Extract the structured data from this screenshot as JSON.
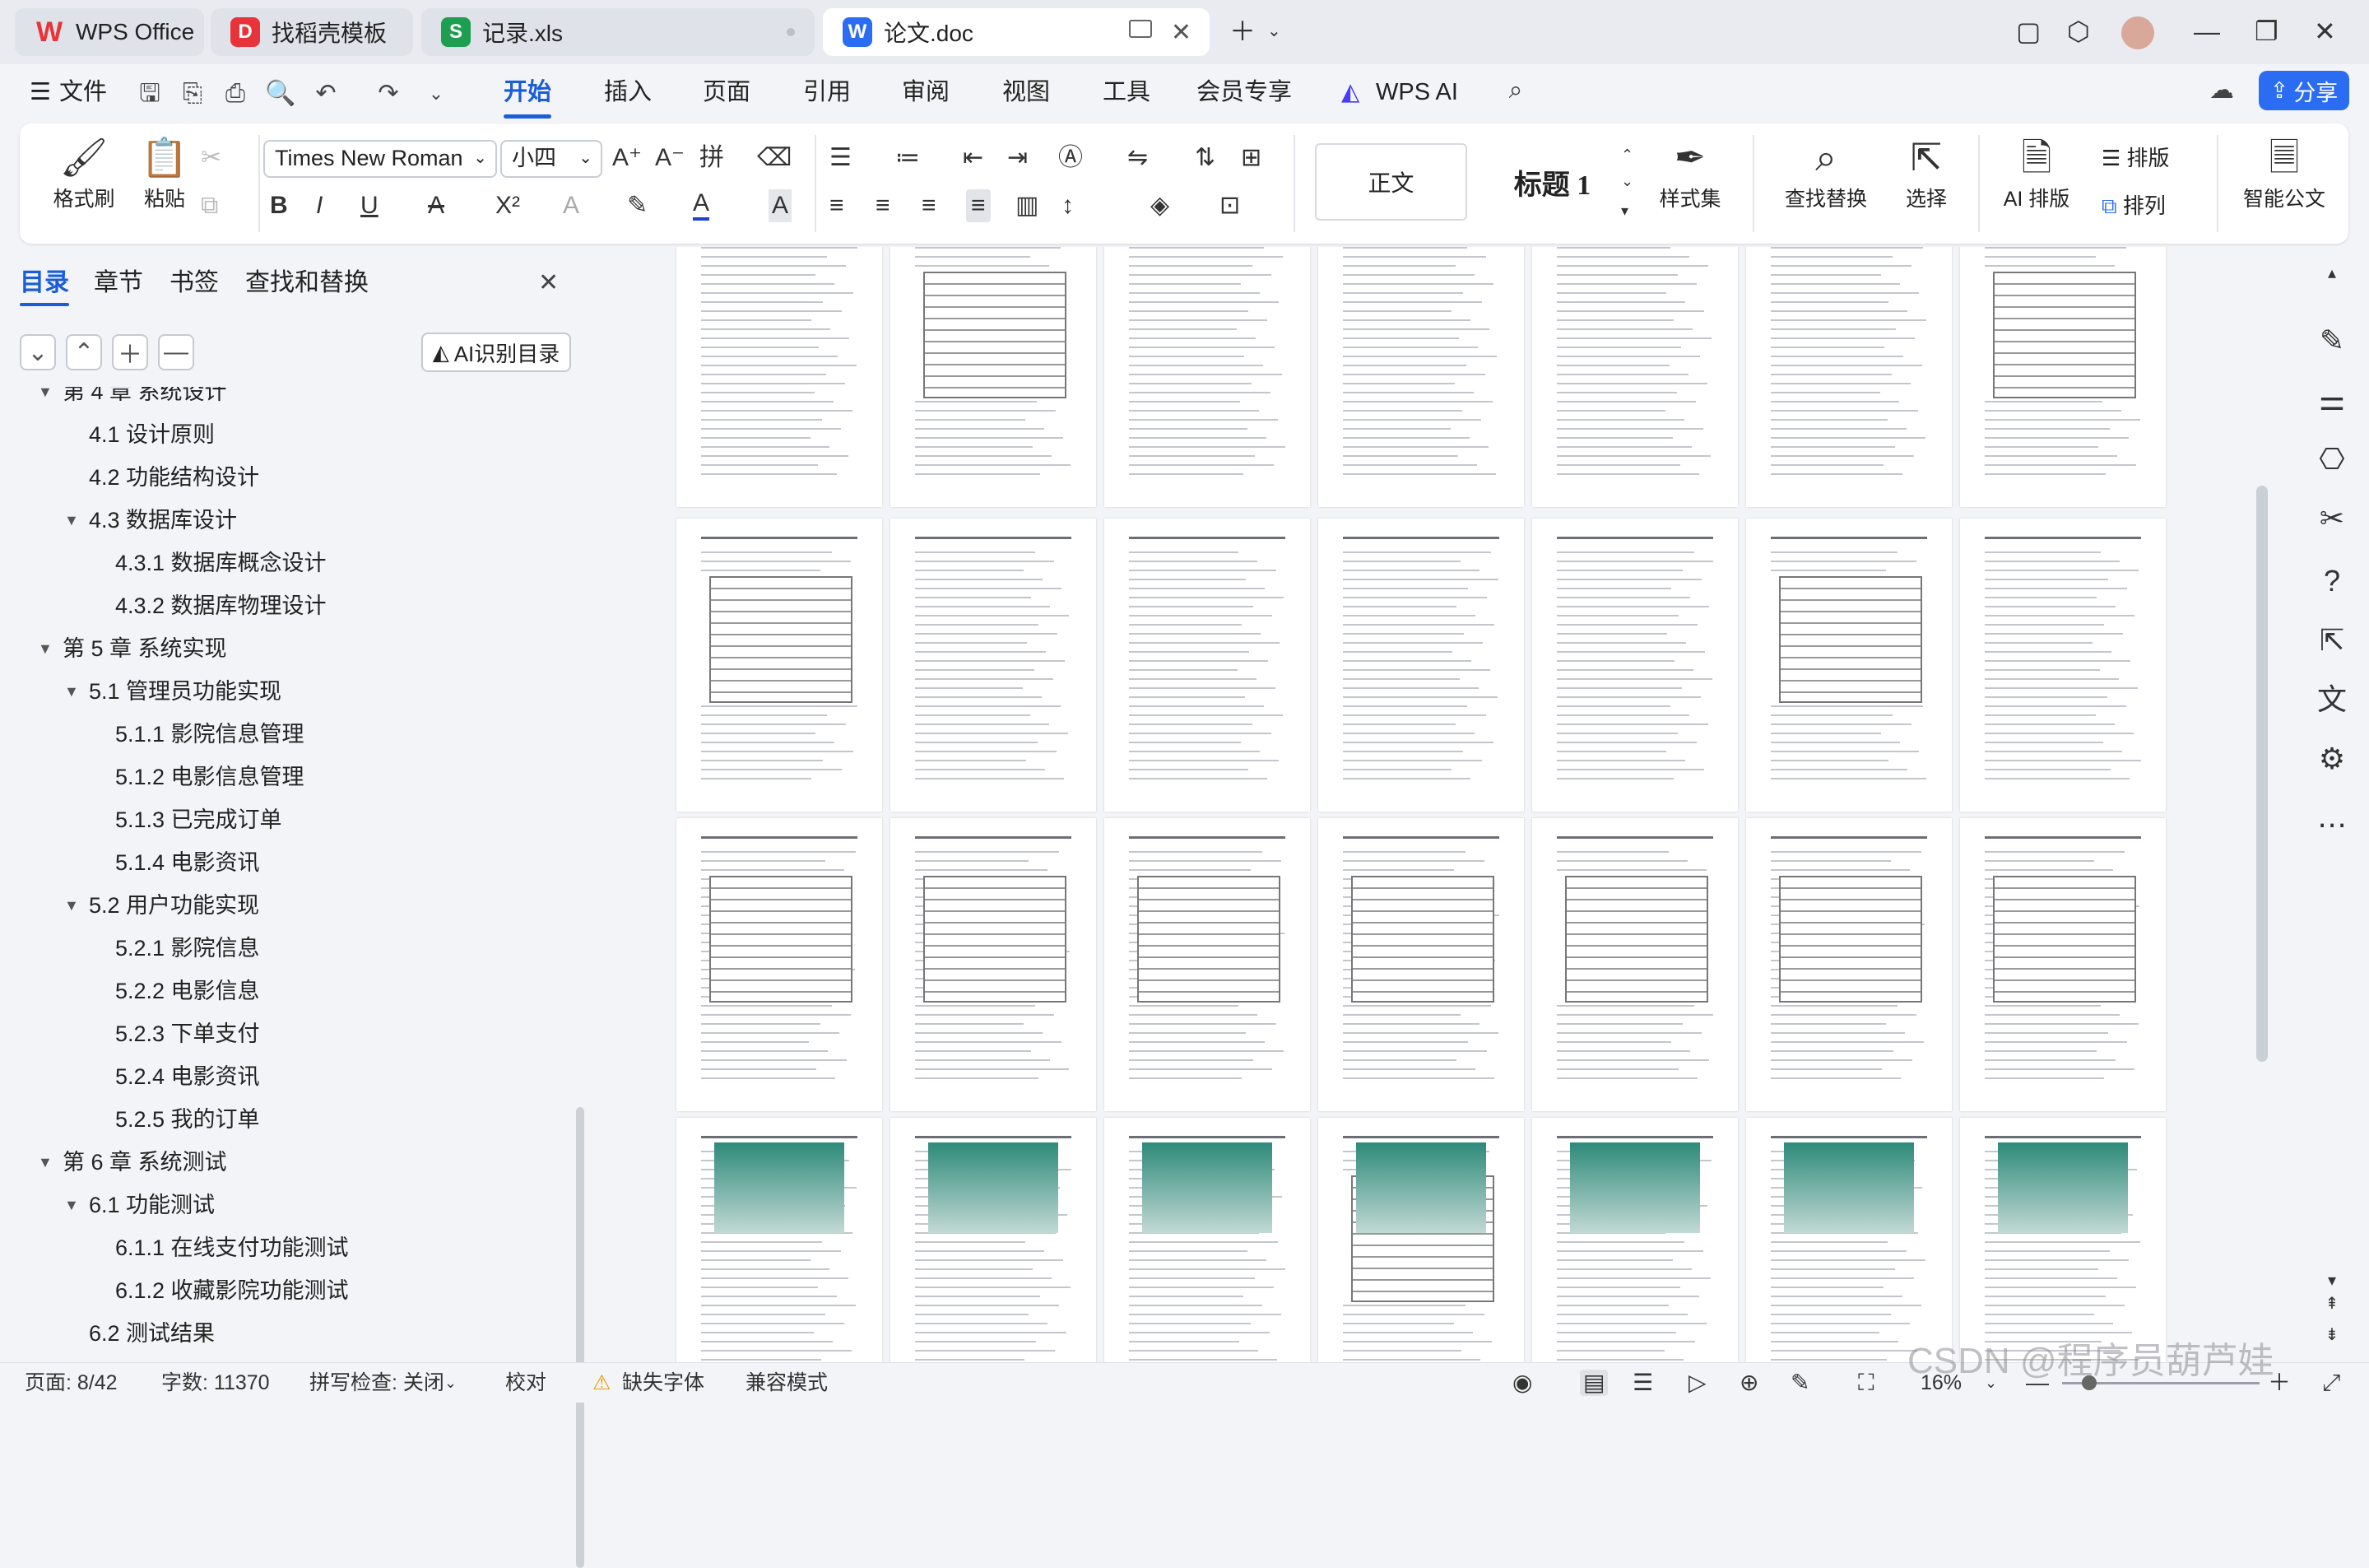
{
  "tabs": [
    {
      "label": "WPS Office",
      "icon": "W",
      "color": "#e8333a"
    },
    {
      "label": "找稻壳模板",
      "icon": "D",
      "color": "#e8333a"
    },
    {
      "label": "记录.xls",
      "icon": "S",
      "color": "#1e9e50"
    },
    {
      "label": "论文.doc",
      "icon": "W",
      "color": "#2b6df2"
    }
  ],
  "menu": {
    "file": "文件",
    "items": [
      "开始",
      "插入",
      "页面",
      "引用",
      "审阅",
      "视图",
      "工具",
      "会员专享"
    ],
    "wps_ai": "WPS AI",
    "share": "分享"
  },
  "ribbon": {
    "format_painter": "格式刷",
    "paste": "粘贴",
    "font_name": "Times New Roman",
    "font_size": "小四",
    "style_normal": "正文",
    "style_heading": "标题 1",
    "style_set": "样式集",
    "find_replace": "查找替换",
    "select": "选择",
    "ai_layout": "AI 排版",
    "layout": "排版",
    "arrange": "排列",
    "smart_doc": "智能公文"
  },
  "panel": {
    "tabs": [
      "目录",
      "章节",
      "书签",
      "查找和替换"
    ],
    "ai_toc": "AI识别目录",
    "toc": [
      {
        "label": "第 4 章  系统设计",
        "level": 1,
        "arrow": true
      },
      {
        "label": "4.1  设计原则",
        "level": 2,
        "arrow": false
      },
      {
        "label": "4.2  功能结构设计",
        "level": 2,
        "arrow": false
      },
      {
        "label": "4.3  数据库设计",
        "level": 2,
        "arrow": true
      },
      {
        "label": "4.3.1  数据库概念设计",
        "level": 3,
        "arrow": false
      },
      {
        "label": "4.3.2  数据库物理设计",
        "level": 3,
        "arrow": false
      },
      {
        "label": "第 5 章  系统实现",
        "level": 1,
        "arrow": true
      },
      {
        "label": "5.1  管理员功能实现",
        "level": 2,
        "arrow": true
      },
      {
        "label": "5.1.1  影院信息管理",
        "level": 3,
        "arrow": false
      },
      {
        "label": "5.1.2  电影信息管理",
        "level": 3,
        "arrow": false
      },
      {
        "label": "5.1.3  已完成订单",
        "level": 3,
        "arrow": false
      },
      {
        "label": "5.1.4  电影资讯",
        "level": 3,
        "arrow": false
      },
      {
        "label": "5.2  用户功能实现",
        "level": 2,
        "arrow": true
      },
      {
        "label": "5.2.1  影院信息",
        "level": 3,
        "arrow": false
      },
      {
        "label": "5.2.2  电影信息",
        "level": 3,
        "arrow": false
      },
      {
        "label": "5.2.3  下单支付",
        "level": 3,
        "arrow": false
      },
      {
        "label": "5.2.4  电影资讯",
        "level": 3,
        "arrow": false
      },
      {
        "label": "5.2.5  我的订单",
        "level": 3,
        "arrow": false
      },
      {
        "label": "第 6 章  系统测试",
        "level": 1,
        "arrow": true
      },
      {
        "label": "6.1  功能测试",
        "level": 2,
        "arrow": true
      },
      {
        "label": "6.1.1  在线支付功能测试",
        "level": 3,
        "arrow": false
      },
      {
        "label": "6.1.2  收藏影院功能测试",
        "level": 3,
        "arrow": false
      },
      {
        "label": "6.2  测试结果",
        "level": 2,
        "arrow": false
      }
    ]
  },
  "status": {
    "page": "页面: 8/42",
    "words": "字数: 11370",
    "spell": "拼写检查: 关闭",
    "proofread": "校对",
    "missing_font": "缺失字体",
    "compat": "兼容模式",
    "zoom": "16%"
  },
  "watermark": "CSDN @程序员葫芦娃",
  "accent": "#1a5dd8"
}
